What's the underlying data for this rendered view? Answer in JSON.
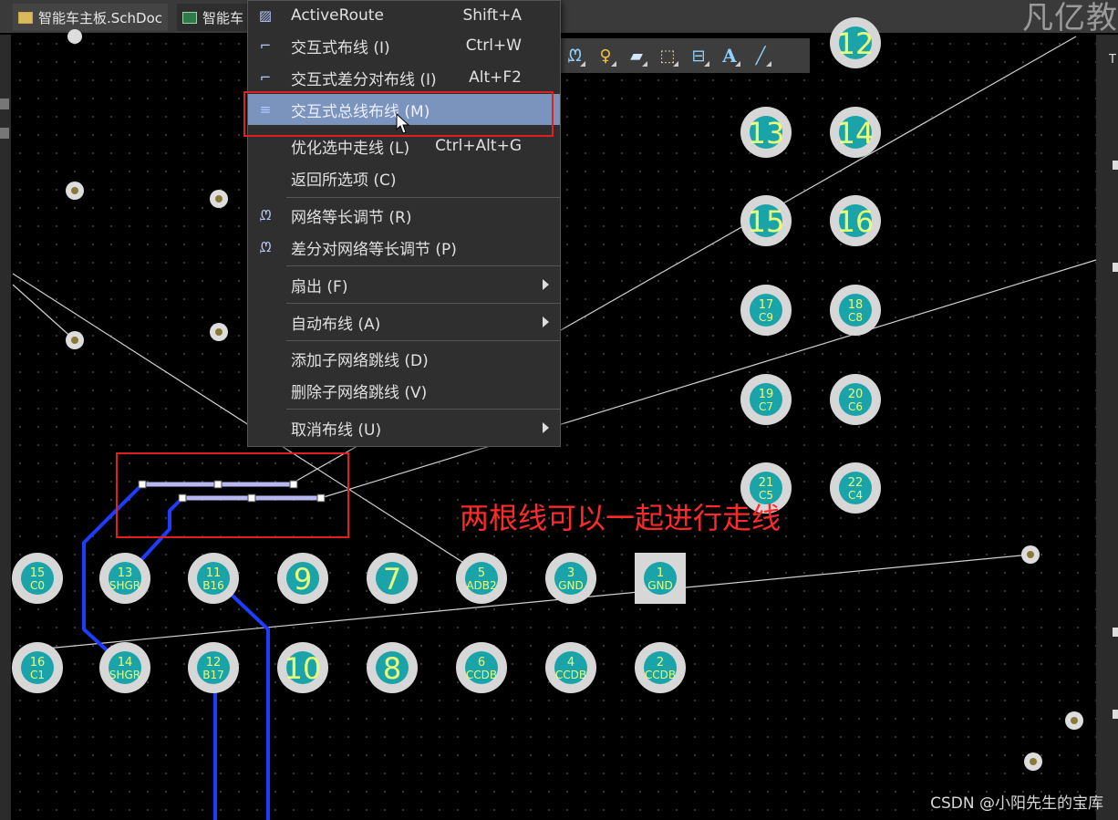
{
  "tabs": [
    {
      "label": "智能车主板.SchDoc",
      "kind": "sch"
    },
    {
      "label": "智能车",
      "kind": "pcb"
    }
  ],
  "brand_text": "凡亿教",
  "toolbar": {
    "tools": [
      {
        "icon": "wave-tune-icon",
        "glyph": "ᘻ"
      },
      {
        "icon": "pin-icon",
        "glyph": "♀"
      },
      {
        "icon": "fill-icon",
        "glyph": "▰"
      },
      {
        "icon": "dimension-icon",
        "glyph": "⬚"
      },
      {
        "icon": "component-icon",
        "glyph": "⊟"
      },
      {
        "icon": "text-icon",
        "glyph": "A"
      },
      {
        "icon": "line-icon",
        "glyph": "╱"
      }
    ]
  },
  "menu": {
    "items": [
      {
        "label": "ActiveRoute",
        "shortcut": "Shift+A",
        "icon": "activeroute-icon",
        "glyph": "▨"
      },
      {
        "label": "交互式布线 (I)",
        "shortcut": "Ctrl+W",
        "icon": "route-icon",
        "glyph": "⌐"
      },
      {
        "label": "交互式差分对布线 (I)",
        "shortcut": "Alt+F2",
        "icon": "diff-route-icon",
        "glyph": "⌐"
      },
      {
        "label": "交互式总线布线 (M)",
        "shortcut": "",
        "icon": "bus-route-icon",
        "glyph": "≡",
        "highlight": true
      },
      {
        "label": "优化选中走线 (L)",
        "shortcut": "Ctrl+Alt+G",
        "icon": "",
        "glyph": ""
      },
      {
        "label": "返回所选项 (C)",
        "shortcut": "",
        "icon": "",
        "glyph": ""
      },
      {
        "label": "网络等长调节 (R)",
        "shortcut": "",
        "icon": "length-tune-icon",
        "glyph": "ᘻ"
      },
      {
        "label": "差分对网络等长调节 (P)",
        "shortcut": "",
        "icon": "diff-tune-icon",
        "glyph": "ᘻ"
      },
      {
        "label": "扇出 (F)",
        "shortcut": "",
        "icon": "",
        "glyph": "",
        "submenu": true
      },
      {
        "label": "自动布线 (A)",
        "shortcut": "",
        "icon": "",
        "glyph": "",
        "submenu": true
      },
      {
        "label": "添加子网络跳线 (D)",
        "shortcut": "",
        "icon": "",
        "glyph": ""
      },
      {
        "label": "删除子网络跳线 (V)",
        "shortcut": "",
        "icon": "",
        "glyph": ""
      },
      {
        "label": "取消布线 (U)",
        "shortcut": "",
        "icon": "",
        "glyph": "",
        "submenu": true
      }
    ]
  },
  "annotation": "两根线可以一起进行走线",
  "watermark": "CSDN @小阳先生的宝库",
  "pads_right": [
    {
      "num": "12",
      "net": ""
    },
    {
      "num": "13",
      "net": ""
    },
    {
      "num": "14",
      "net": ""
    },
    {
      "num": "15",
      "net": ""
    },
    {
      "num": "16",
      "net": ""
    },
    {
      "num": "17",
      "net": "C9"
    },
    {
      "num": "18",
      "net": "C8"
    },
    {
      "num": "19",
      "net": "C7"
    },
    {
      "num": "20",
      "net": "C6"
    },
    {
      "num": "21",
      "net": "C5"
    },
    {
      "num": "22",
      "net": "C4"
    }
  ],
  "pads_row1": [
    {
      "num": "15",
      "net": "C0"
    },
    {
      "num": "13",
      "net": "SHGR"
    },
    {
      "num": "11",
      "net": "B16"
    },
    {
      "num": "9",
      "net": ""
    },
    {
      "num": "7",
      "net": ""
    },
    {
      "num": "5",
      "net": "ADB2"
    },
    {
      "num": "3",
      "net": "GND"
    },
    {
      "num": "1",
      "net": "GND"
    }
  ],
  "pads_row2": [
    {
      "num": "16",
      "net": "C1"
    },
    {
      "num": "14",
      "net": "SHGR"
    },
    {
      "num": "12",
      "net": "B17"
    },
    {
      "num": "10",
      "net": ""
    },
    {
      "num": "8",
      "net": ""
    },
    {
      "num": "6",
      "net": "CCDB"
    },
    {
      "num": "4",
      "net": "CCDB"
    },
    {
      "num": "2",
      "net": "CCDB"
    }
  ],
  "colors": {
    "pad_ring": "#d7d7d7",
    "pad_core": "#1aa3a8",
    "pad_text": "#e8ff7a",
    "trace": "#1e3cff",
    "ratsnest": "#cfcfcf",
    "selected_trace": "#b8b8f0",
    "menu_highlight": "#7a94bd",
    "annotation": "#ff2a2a"
  }
}
